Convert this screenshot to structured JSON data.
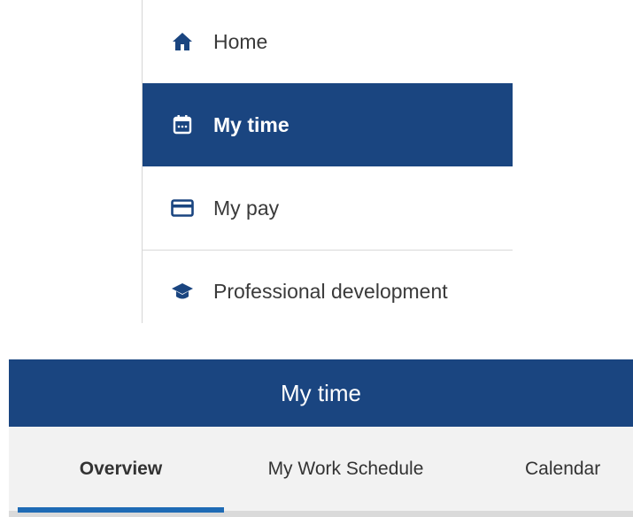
{
  "sidebar": {
    "items": [
      {
        "label": "Home",
        "icon": "home-icon",
        "active": false
      },
      {
        "label": "My time",
        "icon": "calendar-icon",
        "active": true
      },
      {
        "label": "My pay",
        "icon": "credit-card-icon",
        "active": false
      },
      {
        "label": "Professional development",
        "icon": "graduation-cap-icon",
        "active": false
      }
    ]
  },
  "header": {
    "title": "My time"
  },
  "tabs": [
    {
      "label": "Overview",
      "active": true
    },
    {
      "label": "My Work Schedule",
      "active": false
    },
    {
      "label": "Calendar",
      "active": false
    }
  ],
  "colors": {
    "brand_navy": "#1a4580",
    "active_tab_indicator": "#1f6bb5",
    "tabbar_background": "#f2f2f2"
  }
}
